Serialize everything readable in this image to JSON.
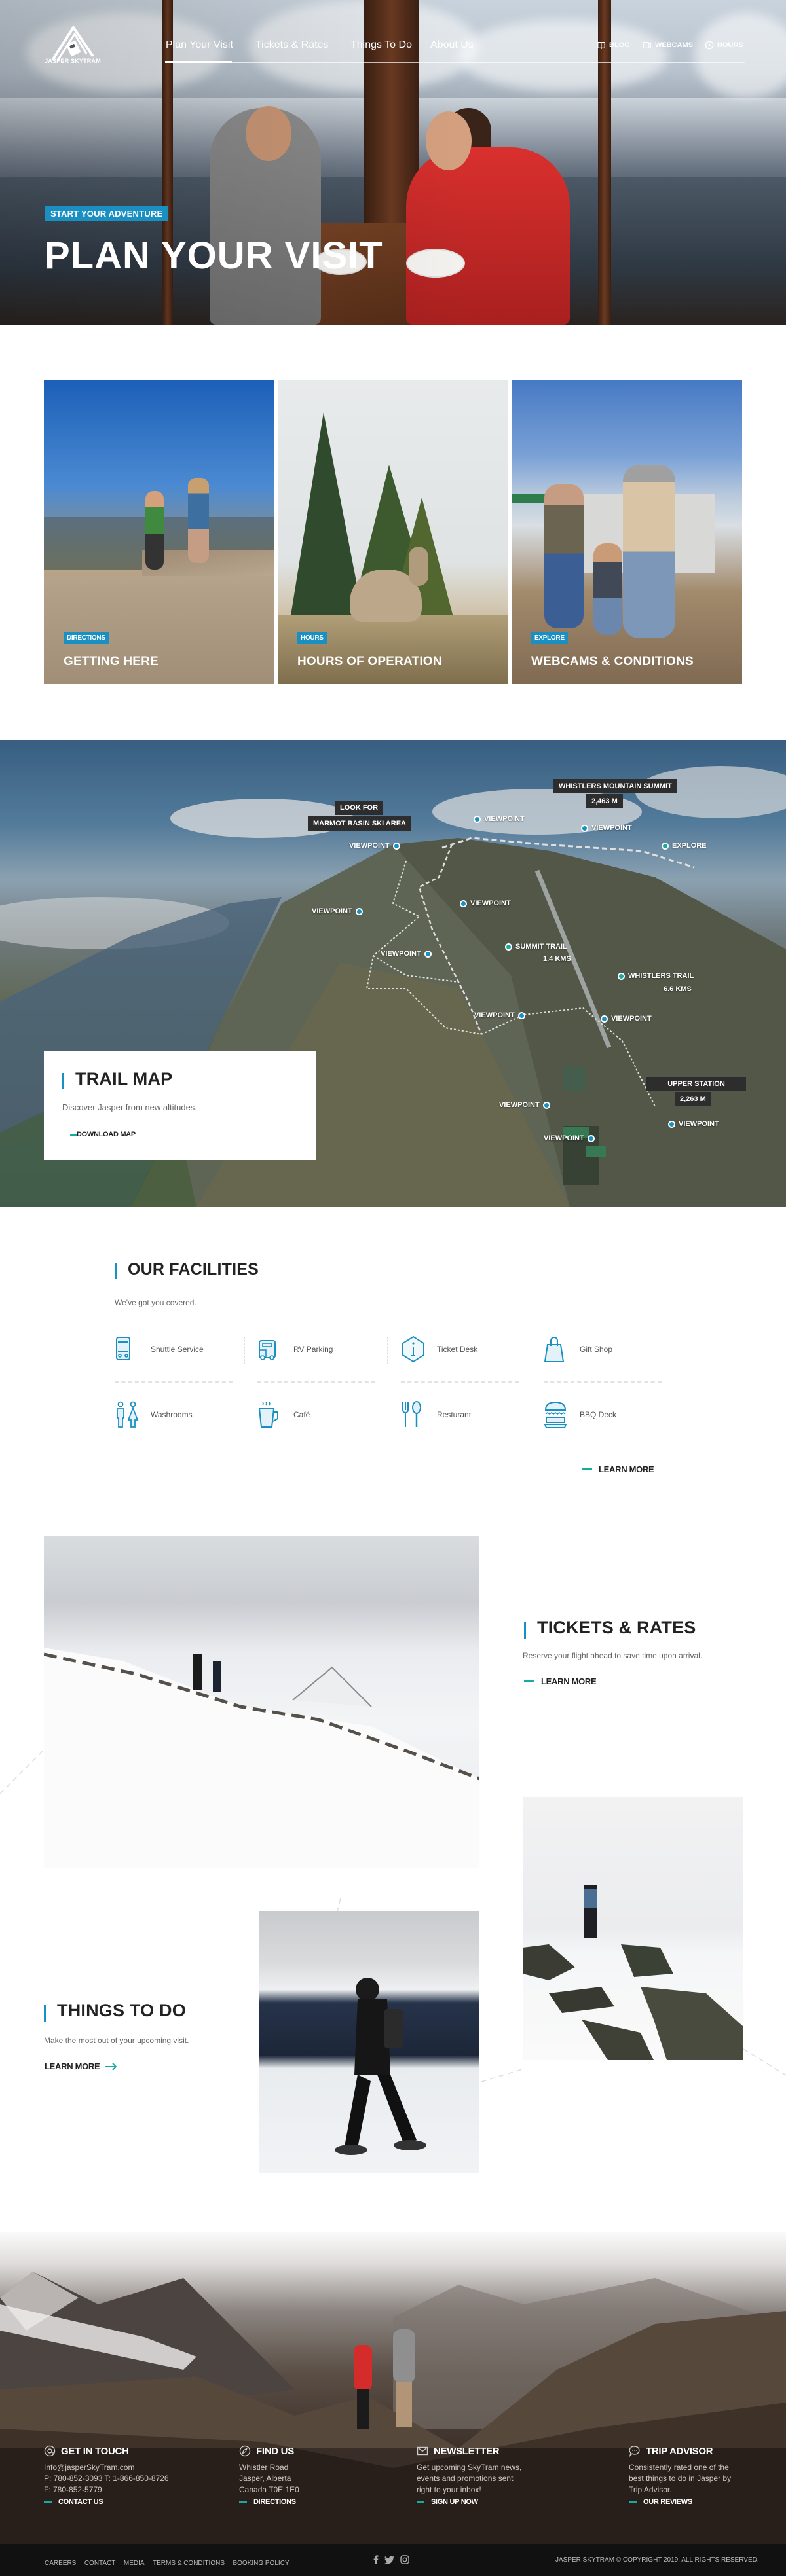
{
  "brand": {
    "name": "JASPER SKYTRAM",
    "accent": "#1a8fc2",
    "teal": "#17aaa0",
    "dark_tag": "#2d2d2d"
  },
  "nav": {
    "items": [
      {
        "label": "Plan Your Visit",
        "active": true
      },
      {
        "label": "Tickets & Rates",
        "active": false
      },
      {
        "label": "Things To Do",
        "active": false
      },
      {
        "label": "About Us",
        "active": false
      }
    ],
    "utility": [
      {
        "label": "BLOG",
        "icon": "book-icon"
      },
      {
        "label": "WEBCAMS",
        "icon": "video-icon"
      },
      {
        "label": "HOURS",
        "icon": "clock-icon"
      }
    ]
  },
  "hero": {
    "kicker": "START YOUR ADVENTURE",
    "title": "PLAN YOUR VISIT"
  },
  "cards": [
    {
      "badge": "DIRECTIONS",
      "title": "GETTING HERE"
    },
    {
      "badge": "HOURS",
      "title": "HOURS OF OPERATION"
    },
    {
      "badge": "EXPLORE",
      "title": "WEBCAMS & CONDITIONS"
    }
  ],
  "trail_map": {
    "title": "TRAIL MAP",
    "description": "Discover Jasper from new altitudes.",
    "cta": "DOWNLOAD MAP",
    "tags": {
      "look_for": "LOOK FOR",
      "marmot": "MARMOT BASIN SKI AREA",
      "summit": "WHISTLERS MOUNTAIN SUMMIT",
      "summit_elev": "2,463 M",
      "upper": "UPPER STATION",
      "upper_elev": "2,263 M"
    },
    "points": {
      "viewpoint": "VIEWPOINT",
      "explore": "EXPLORE",
      "summit_trail": "SUMMIT TRAIL",
      "summit_trail_len": "1.4 KMS",
      "whistlers_trail": "WHISTLERS TRAIL",
      "whistlers_trail_len": "6.6 KMS"
    }
  },
  "facilities": {
    "title": "OUR FACILITIES",
    "subtitle": "We've got you covered.",
    "items": [
      {
        "label": "Shuttle Service",
        "icon": "bus-icon"
      },
      {
        "label": "RV Parking",
        "icon": "rv-icon"
      },
      {
        "label": "Ticket Desk",
        "icon": "info-icon"
      },
      {
        "label": "Gift Shop",
        "icon": "shopping-bag-icon"
      },
      {
        "label": "Washrooms",
        "icon": "washroom-icon"
      },
      {
        "label": "Café",
        "icon": "coffee-icon"
      },
      {
        "label": "Resturant",
        "icon": "fork-spoon-icon"
      },
      {
        "label": "BBQ Deck",
        "icon": "burger-icon"
      }
    ],
    "cta": "LEARN MORE"
  },
  "tickets": {
    "title": "TICKETS & RATES",
    "description": "Reserve your flight ahead to save time upon arrival.",
    "cta": "LEARN MORE"
  },
  "things": {
    "title": "THINGS TO DO",
    "description": "Make the most out of your upcoming visit.",
    "cta": "LEARN MORE"
  },
  "footer": {
    "contact": {
      "title": "GET IN TOUCH",
      "email": "Info@jasperSkyTram.com",
      "phone_line": "P: 780-852-3093  T: 1-866-850-8726",
      "fax": "F: 780-852-5779",
      "cta": "CONTACT US"
    },
    "find": {
      "title": "FIND US",
      "line1": "Whistler Road",
      "line2": "Jasper, Alberta",
      "line3": "Canada T0E 1E0",
      "cta": "DIRECTIONS"
    },
    "newsletter": {
      "title": "NEWSLETTER",
      "text": "Get upcoming SkyTram news, events and promotions sent right to your inbox!",
      "cta": "SIGN UP NOW"
    },
    "tripadvisor": {
      "title": "TRIP ADVISOR",
      "text": "Consistently rated one of the best things to do in Jasper by Trip Advisor.",
      "cta": "OUR REVIEWS"
    },
    "links": [
      "CAREERS",
      "CONTACT",
      "MEDIA",
      "TERMS & CONDITIONS",
      "BOOKING POLICY"
    ],
    "social": [
      "facebook-icon",
      "twitter-icon",
      "instagram-icon"
    ],
    "copyright": "JASPER SKYTRAM  © COPYRIGHT 2019. ALL RIGHTS RESERVED."
  }
}
